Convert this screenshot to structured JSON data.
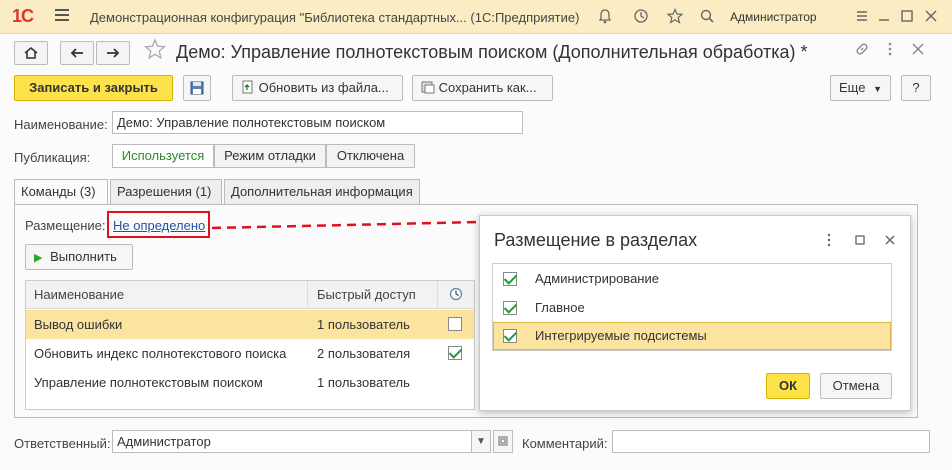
{
  "app": {
    "logo": "1С",
    "title": "Демонстрационная конфигурация \"Библиотека стандартных...  (1С:Предприятие)",
    "user": "Администратор"
  },
  "form": {
    "title": "Демо: Управление полнотекстовым поиском (Дополнительная обработка) *"
  },
  "toolbar": {
    "save_close": "Записать и закрыть",
    "update_from_file": "Обновить из файла...",
    "save_as": "Сохранить как...",
    "more": "Еще",
    "help": "?"
  },
  "fields": {
    "name_label": "Наименование:",
    "name_value": "Демо: Управление полнотекстовым поиском",
    "publication_label": "Публикация:",
    "publication_options": [
      "Используется",
      "Режим отладки",
      "Отключена"
    ],
    "responsible_label": "Ответственный:",
    "responsible_value": "Администратор",
    "comment_label": "Комментарий:",
    "comment_value": ""
  },
  "tabs": [
    "Команды (3)",
    "Разрешения (1)",
    "Дополнительная информация"
  ],
  "commands": {
    "placement_label": "Размещение:",
    "placement_value": "Не определено",
    "run_button": "Выполнить",
    "columns": [
      "Наименование",
      "Быстрый доступ"
    ],
    "rows": [
      {
        "name": "Вывод ошибки",
        "access": "1 пользователь",
        "checked": false
      },
      {
        "name": "Обновить индекс полнотекстового поиска",
        "access": "2 пользователя",
        "checked": true
      },
      {
        "name": "Управление полнотекстовым поиском",
        "access": "1 пользователь",
        "checked": false
      }
    ]
  },
  "dialog": {
    "title": "Размещение в разделах",
    "items": [
      {
        "label": "Администрирование",
        "checked": true
      },
      {
        "label": "Главное",
        "checked": true
      },
      {
        "label": "Интегрируемые подсистемы",
        "checked": true
      }
    ],
    "ok": "ОК",
    "cancel": "Отмена"
  },
  "colors": {
    "accent_yellow": "#fde24a",
    "highlight_red": "#e0101e",
    "selection": "#fbe3a0",
    "check_green": "#1e9e3a"
  }
}
